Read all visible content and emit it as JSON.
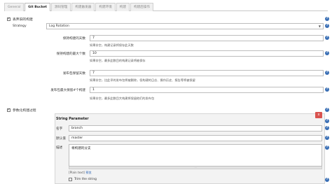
{
  "tabs": [
    "General",
    "Git Bucket",
    "源码管理",
    "构建触发器",
    "构建环境",
    "构建",
    "构建后操作"
  ],
  "discard": {
    "label": "丢弃旧的构建",
    "strategy_label": "Strategy",
    "strategy_value": "Log Rotation",
    "rows": [
      {
        "label": "保持构建的天数",
        "value": "7",
        "hint": "如果非空，构建记录将保存此天数"
      },
      {
        "label": "保持构建的最大个数",
        "value": "10",
        "hint": "如果非空，最多此数目的构建记录将被保存"
      },
      {
        "label": "发布包保留天数",
        "value": "7",
        "hint": "如果非空，比此早的发布包将被删除，但构建的日志、操作历史、报告等将被保留"
      },
      {
        "label": "发布包最大保留#个构建",
        "value": "1",
        "hint": "如果非空，最多此数目大构建将保留他们的发布包"
      }
    ]
  },
  "parameterized": {
    "label": "参数化构建过程",
    "panel_title": "String Parameter",
    "close": "x",
    "name_label": "名字",
    "name_value": "branch",
    "default_label": "默认值",
    "default_value": "master",
    "desc_label": "描述",
    "desc_value": "将构建的分支",
    "plain_text": "[Plain text]",
    "preview": "预览",
    "trim_label": "Trim the string"
  },
  "help_icon_glyph": "?"
}
